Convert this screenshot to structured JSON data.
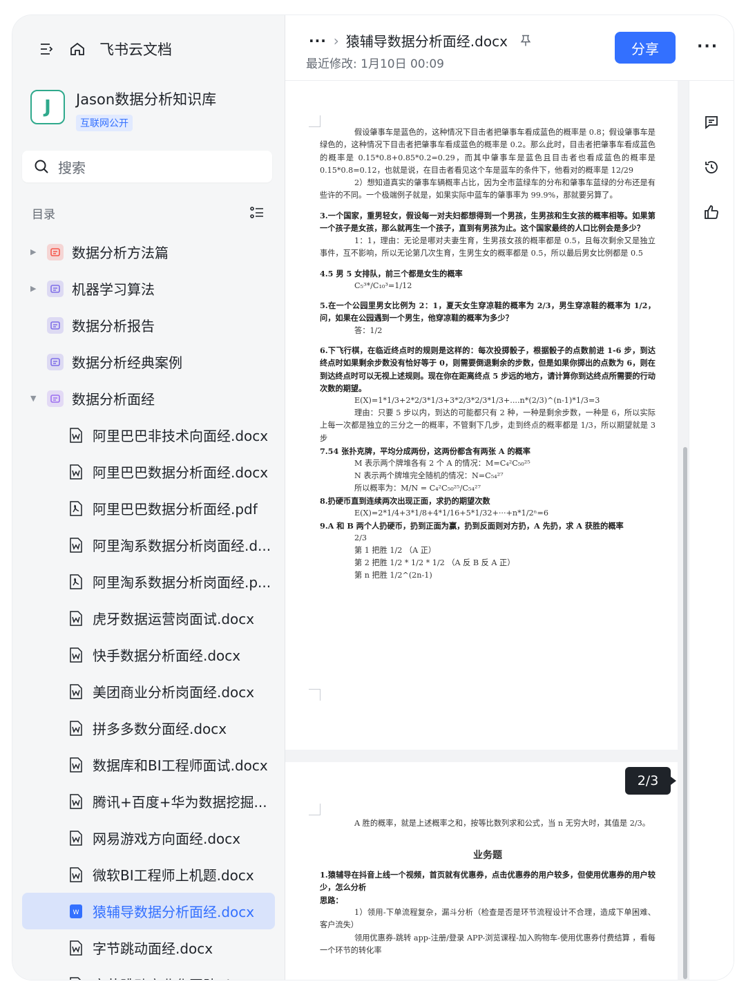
{
  "app": {
    "name": "飞书云文档"
  },
  "knowledge_base": {
    "avatar_letter": "J",
    "title": "Jason数据分析知识库",
    "badge": "互联网公开"
  },
  "search": {
    "placeholder": "搜索"
  },
  "toc": {
    "label": "目录"
  },
  "tree": {
    "categories": [
      {
        "label": "数据分析方法篇",
        "color": "#f5574b",
        "expanded": false
      },
      {
        "label": "机器学习算法",
        "color": "#7f6ee8",
        "expanded": false
      },
      {
        "label": "数据分析报告",
        "color": "#7f6ee8"
      },
      {
        "label": "数据分析经典案例",
        "color": "#7f6ee8"
      },
      {
        "label": "数据分析面经",
        "color": "#9d6ff0",
        "expanded": true
      }
    ],
    "docs": [
      "阿里巴巴非技术向面经.docx",
      "阿里巴巴数据分析面经.docx",
      "阿里巴巴数据分析面经.pdf",
      "阿里淘系数据分析岗面经.d...",
      "阿里淘系数据分析岗面经.p...",
      "虎牙数据运营岗面试.docx",
      "快手数据分析面经.docx",
      "美团商业分析岗面经.docx",
      "拼多多数分面经.docx",
      "数据库和BI工程师面试.docx",
      "腾讯+百度+华为数据挖掘...",
      "网易游戏方向面经.docx",
      "微软BI工程师上机题.docx",
      "猿辅导数据分析面经.docx",
      "字节跳动面经.docx",
      "字节跳动商业化团队.docx"
    ]
  },
  "header": {
    "breadcrumb_dots": "···",
    "breadcrumb_sep": "›",
    "doc_title": "猿辅导数据分析面经.docx",
    "last_modified": "最近修改: 1月10日 00:09",
    "share_label": "分享",
    "more_label": "···"
  },
  "document": {
    "page_badge": "2/3",
    "page1": [
      {
        "t": "假设肇事车是蓝色的，这种情况下目击者把肇事车看成蓝色的概率是 0.8；假设肇事车是绿色的，这种情况下目击者把肇事车看成蓝色的概率是 0.2。那么此时，目击者把肇事车看成蓝色的概率是 0.15*0.8+0.85*0.2=0.29，而其中肇事车是蓝色且目击者也看成蓝色的概率是 0.15*0.8=0.12，也就是说，在目击者看见这个车是蓝车的条件下，他看对的概率是 12/29",
        "cls": "ind"
      },
      {
        "t": "2）想知道真实的肇事车辆概率占比，因为全市蓝绿车的分布和肇事车蓝绿的分布还是有些许的不同。一个极端例子就是，如果实际中蓝车的肇事率为 99.9%，那就要另算了。",
        "cls": "ind"
      },
      {
        "t": "3.一个国家，重男轻女，假设每一对夫妇都想得到一个男孩，生男孩和生女孩的概率相等。如果第一个孩子是女孩，那么就再生一个孩子，直到有男孩为止。这个国家最终的人口比例会是多少？",
        "cls": "b"
      },
      {
        "t": "1：1，理由：无论是哪对夫妻生育，生男孩女孩的概率都是 0.5，且每次剩余又是独立事件，互不影响，所以无论第几次生育，生男生女的概率都是 0.5，所以最后男女比例都是 0.5",
        "cls": "ind"
      },
      {
        "t": "4.5 男 5 女排队，前三个都是女生的概率",
        "cls": "b"
      },
      {
        "t": "C₅³*/C₁₀³=1/12",
        "cls": "ind"
      },
      {
        "t": "5.在一个公园里男女比例为 2：1，夏天女生穿凉鞋的概率为 2/3，男生穿凉鞋的概率为 1/2，问，如果在公园遇到一个男生，他穿凉鞋的概率为多少？",
        "cls": "b"
      },
      {
        "t": "答：1/2",
        "cls": "ind"
      },
      {
        "t": "6.下飞行棋，在临近终点时的规则是这样的：每次投掷骰子，根据骰子的点数前进 1-6 步，到达终点时如果剩余步数没有恰好等于 0，则需要倒退剩余的步数，但是如果你掷出的点数为 6，则在到达终点时可以无视上述规则。现在你在距离终点 5 步远的地方，请计算你到达终点所需要的行动次数的期望。",
        "cls": "b"
      },
      {
        "t": "E(X)=1*1/3+2*2/3*1/3+3*2/3*2/3*1/3+....n*(2/3)^(n-1)*1/3=3",
        "cls": "ind"
      },
      {
        "t": "理由：只要 5 步以内，到达的可能都只有 2 种，一种是剩余步数，一种是 6，所以实际上每一次都是独立的三分之一的概率，不管剩下几步，走到终点的概率都是 1/3，所以期望就是 3 步",
        "cls": "ind"
      },
      {
        "t": "7.54 张扑克牌，平均分成两份，这两份都含有两张 A 的概率",
        "cls": "b"
      },
      {
        "t": "M 表示两个牌堆各有 2 个 A 的情况：M=C₄²C₅₀²⁵",
        "cls": "ind"
      },
      {
        "t": "N 表示两个牌堆完全随机的情况：N=C₅₄²⁷",
        "cls": "ind"
      },
      {
        "t": "所以概率为：M/N = C₄²C₅₀²⁵/C₅₄²⁷",
        "cls": "ind"
      },
      {
        "t": "8.扔硬币直到连续两次出现正面，求扔的期望次数",
        "cls": "b"
      },
      {
        "t": "E(X)=2*1/4+3*1/8+4*1/16+5*1/32+···+n*1/2ⁿ=6",
        "cls": "ind"
      },
      {
        "t": "9.A 和 B 两个人扔硬币，扔到正面为赢，扔到反面则对方扔，A 先扔，求 A 获胜的概率",
        "cls": "b"
      },
      {
        "t": "2/3",
        "cls": "ind"
      },
      {
        "t": "第 1 把胜 1/2 （A 正）",
        "cls": "ind"
      },
      {
        "t": "第 2 把胜 1/2 * 1/2 * 1/2 （A 反 B 反 A 正）",
        "cls": "ind"
      },
      {
        "t": "第 n 把胜 1/2^(2n-1)",
        "cls": "ind"
      }
    ],
    "page2": [
      {
        "t": "A 胜的概率，就是上述概率之和，按等比数列求和公式，当 n 无穷大时，其值是 2/3。",
        "cls": "ind"
      },
      {
        "t": "业务题",
        "cls": "center"
      },
      {
        "t": "1.猿辅导在抖音上线一个视频，首页就有优惠券，点击优惠券的用户较多，但使用优惠券的用户较少，怎么分析",
        "cls": "b"
      },
      {
        "t": "思路：",
        "cls": "b"
      },
      {
        "t": "1）领用-下单流程复杂，漏斗分析（检查是否是环节流程设计不合理，造成下单困难、客户流失）",
        "cls": "ind"
      },
      {
        "t": "领用优惠券-跳转 app-注册/登录 APP-浏览课程-加入购物车-使用优惠券付费结算 ，看每一个环节的转化率",
        "cls": "ind"
      }
    ]
  }
}
